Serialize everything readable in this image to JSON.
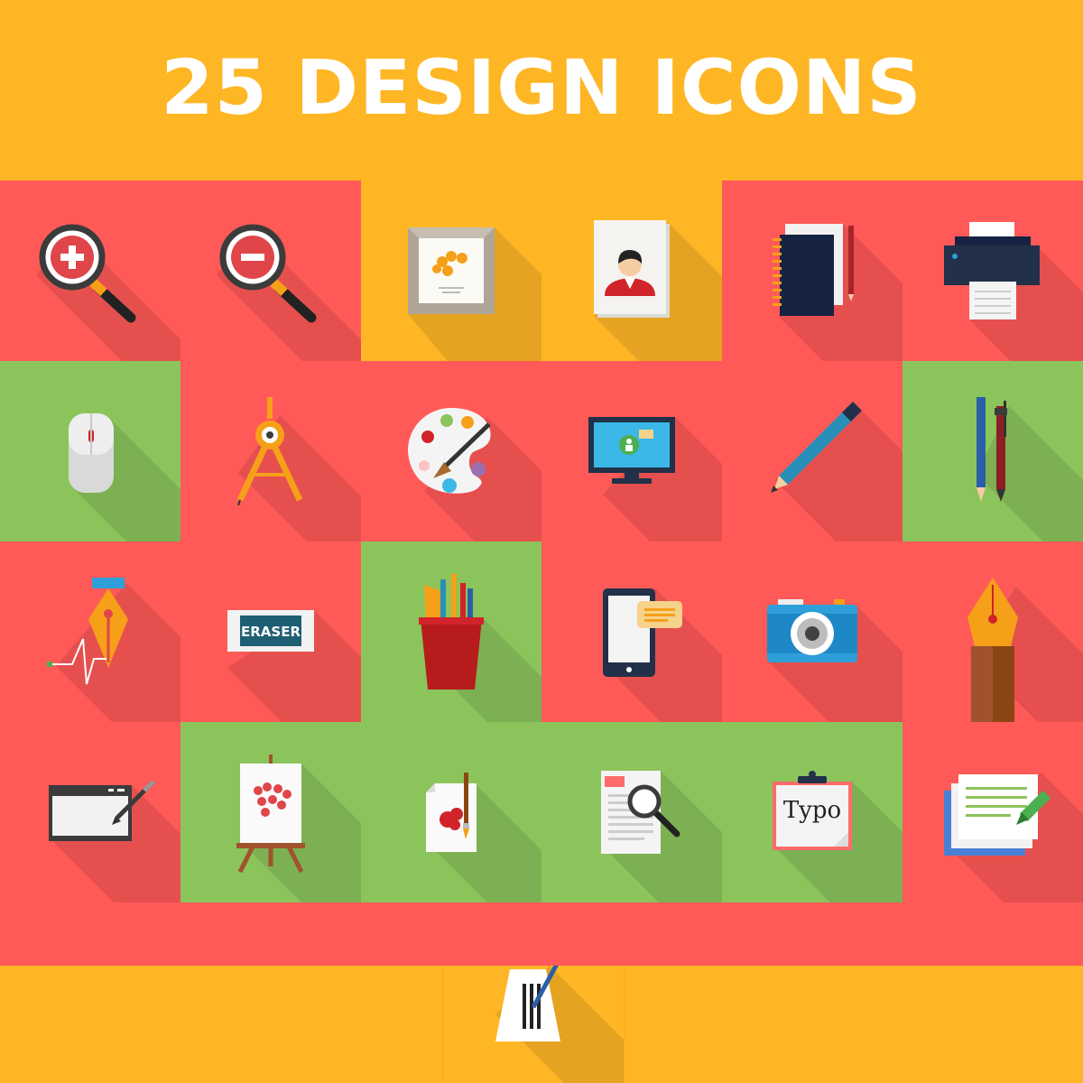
{
  "title": "25 DESIGN ICONS",
  "colors": {
    "orange": "#FEB625",
    "red": "#FF5A57",
    "green": "#8CC45C",
    "white": "#FFFFFF"
  },
  "icons": [
    {
      "name": "zoom-in-icon",
      "bg": "red"
    },
    {
      "name": "zoom-out-icon",
      "bg": "red"
    },
    {
      "name": "picture-frame-icon",
      "bg": "orange"
    },
    {
      "name": "profile-card-icon",
      "bg": "orange"
    },
    {
      "name": "notebook-icon",
      "bg": "red"
    },
    {
      "name": "printer-icon",
      "bg": "red"
    },
    {
      "name": "mouse-icon",
      "bg": "green"
    },
    {
      "name": "compass-icon",
      "bg": "red"
    },
    {
      "name": "paint-palette-icon",
      "bg": "red"
    },
    {
      "name": "monitor-icon",
      "bg": "red"
    },
    {
      "name": "pencil-icon",
      "bg": "red"
    },
    {
      "name": "pens-icon",
      "bg": "green"
    },
    {
      "name": "pen-tool-bezier-icon",
      "bg": "red"
    },
    {
      "name": "eraser-icon",
      "bg": "red"
    },
    {
      "name": "pencil-cup-icon",
      "bg": "green"
    },
    {
      "name": "smartphone-icon",
      "bg": "red"
    },
    {
      "name": "camera-icon",
      "bg": "red"
    },
    {
      "name": "fountain-pen-nib-icon",
      "bg": "red"
    },
    {
      "name": "graphics-tablet-icon",
      "bg": "red"
    },
    {
      "name": "easel-icon",
      "bg": "green"
    },
    {
      "name": "paint-brush-paper-icon",
      "bg": "green"
    },
    {
      "name": "document-search-icon",
      "bg": "green"
    },
    {
      "name": "typography-clipboard-icon",
      "bg": "green"
    },
    {
      "name": "text-document-marker-icon",
      "bg": "red"
    },
    {
      "name": "logo-pen-icon",
      "bg": "orange"
    }
  ],
  "labels": {
    "eraser": "ERASER",
    "typo": "Typo"
  }
}
